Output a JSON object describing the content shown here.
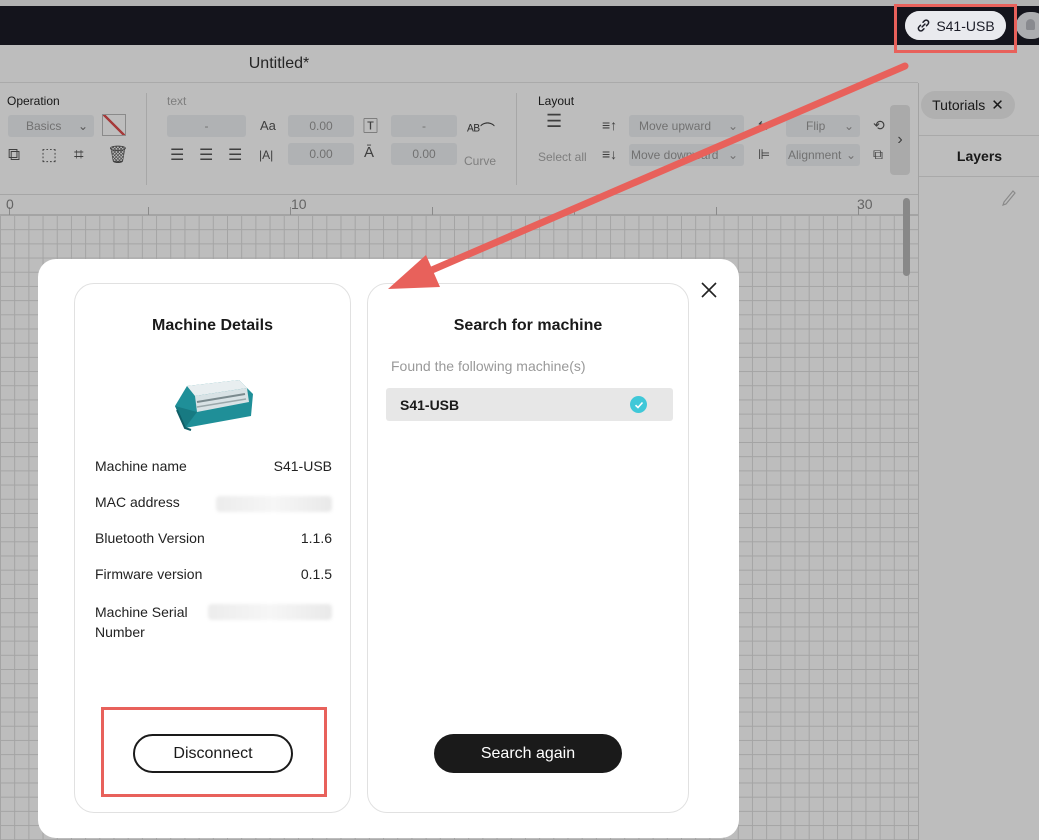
{
  "app": {
    "doc_title": "Untitled*",
    "connection_label": "S41-USB"
  },
  "toolbar": {
    "operation_label": "Operation",
    "basics_select": "Basics",
    "text_label": "text",
    "text_select_1": "-",
    "text_select_2": "-",
    "font_size_glyph": "Aa",
    "font_size_value": "0.00",
    "spacing_glyph": "|A|",
    "spacing_value": "0.00",
    "line_height_value": "0.00",
    "curve_label": "Curve",
    "layout_label": "Layout",
    "select_all_label": "Select all",
    "move_upward_label": "Move upward",
    "move_downward_label": "Move downward",
    "flip_label": "Flip",
    "alignment_label": "Alignment"
  },
  "right_panel": {
    "tutorials_label": "Tutorials",
    "layers_label": "Layers"
  },
  "ruler": {
    "ticks": [
      "0",
      "10",
      "30"
    ]
  },
  "modal": {
    "machine_details": {
      "title": "Machine Details",
      "rows": [
        {
          "key": "Machine name",
          "value": "S41-USB"
        },
        {
          "key": "MAC address",
          "value": ""
        },
        {
          "key": "Bluetooth Version",
          "value": "1.1.6"
        },
        {
          "key": "Firmware version",
          "value": "0.1.5"
        },
        {
          "key": "Machine Serial Number",
          "value": ""
        }
      ],
      "disconnect_label": "Disconnect"
    },
    "search": {
      "title": "Search for machine",
      "found_label": "Found the following machine(s)",
      "machines": [
        "S41-USB"
      ],
      "search_again_label": "Search again"
    }
  },
  "colors": {
    "topbar": "#1b1c27",
    "accent_check": "#40c8d8",
    "highlight": "#e8615b",
    "primary_button": "#1a1a1a"
  }
}
